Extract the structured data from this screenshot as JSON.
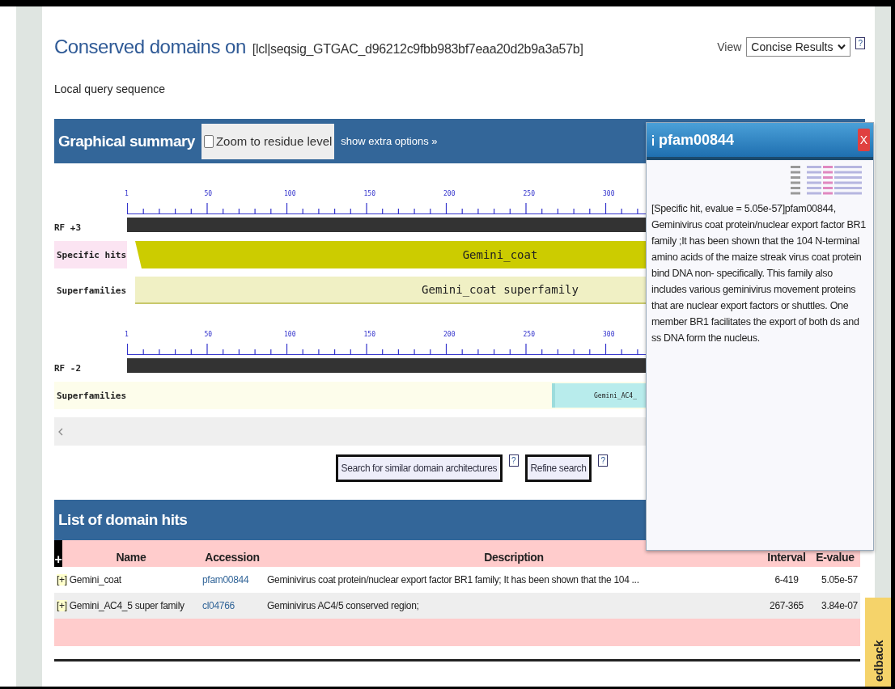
{
  "header": {
    "title": "Conserved domains on",
    "query_id": "[lcl|seqsig_GTGAC_d96212c9fbb983bf7eaa20d2b9a3a57b]",
    "subtitle": "Local query sequence",
    "view_label": "View",
    "view_select": "Concise Results",
    "help": "?"
  },
  "graphical_summary": {
    "title": "Graphical summary",
    "zoom_checkbox": {
      "label": "Zoom to residue level",
      "checked": false
    },
    "extra_options_link": "show extra options »",
    "frames": [
      {
        "label": "RF +3",
        "ticks": [
          "1",
          "50",
          "100",
          "150",
          "200",
          "250",
          "300"
        ],
        "tracks": [
          {
            "kind": "specific",
            "label": "Specific hits",
            "hit": "Gemini_coat",
            "color": "#cccc00"
          },
          {
            "kind": "superfamily",
            "label": "Superfamilies",
            "hit": "Gemini_coat superfamily",
            "color": "#f0f0c4"
          }
        ]
      },
      {
        "label": "RF -2",
        "ticks": [
          "1",
          "50",
          "100",
          "150",
          "200",
          "250",
          "300"
        ],
        "tracks": [
          {
            "kind": "superfamily",
            "label": "Superfamilies",
            "hit": "Gemini_AC4_",
            "color": "#b8ecec"
          }
        ]
      }
    ],
    "buttons": [
      {
        "label": "Search for similar domain architectures",
        "help": "?"
      },
      {
        "label": "Refine search",
        "help": "?"
      }
    ]
  },
  "popup": {
    "title": "pfam00844",
    "close": "X",
    "text": "[Specific hit, evalue = 5.05e-57]pfam00844, Geminivirus coat protein/nuclear export factor BR1 family ;It has been shown that the 104 N-terminal amino acids of the maize streak virus coat protein bind DNA non- specifically. This family also includes various geminivirus movement proteins that are nuclear export factors or shuttles. One member BR1 facilitates the export of both ds and ss DNA form the nucleus."
  },
  "domain_hits": {
    "title": "List of domain hits",
    "expand_all": "+",
    "columns": [
      "Name",
      "Accession",
      "Description",
      "Interval",
      "E-value"
    ],
    "rows": [
      {
        "expander": "[+]",
        "name": "Gemini_coat",
        "accession": "pfam00844",
        "description": "Geminivirus coat protein/nuclear export factor BR1 family; It has been shown that the 104 ...",
        "interval": "6-419",
        "evalue": "5.05e-57"
      },
      {
        "expander": "[+]",
        "name": "Gemini_AC4_5 super family",
        "accession": "cl04766",
        "description": "Geminivirus AC4/5 conserved region;",
        "interval": "267-365",
        "evalue": "3.84e-07"
      }
    ]
  },
  "feedback": "edback"
}
